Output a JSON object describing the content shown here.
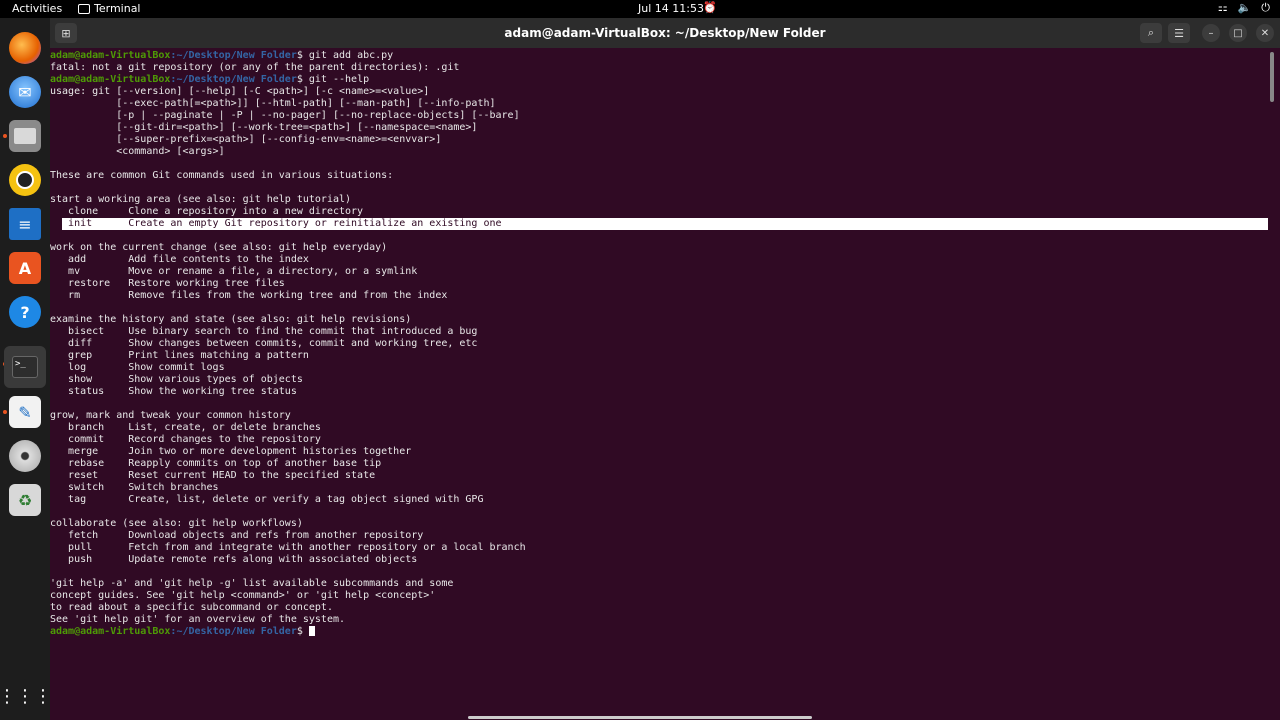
{
  "topbar": {
    "activities": "Activities",
    "app_name": "Terminal",
    "clock": "Jul 14  11:53"
  },
  "dock": {
    "items": [
      "firefox-icon",
      "thunderbird-icon",
      "files-icon",
      "rhythmbox-icon",
      "writer-icon",
      "software-icon",
      "help-icon",
      "terminal-icon",
      "text-editor-icon",
      "disc-icon",
      "trash-icon",
      "show-apps-icon"
    ]
  },
  "window": {
    "title": "adam@adam-VirtualBox: ~/Desktop/New Folder"
  },
  "prompt": {
    "user": "adam@adam-VirtualBox",
    "path": ":~/Desktop/New Folder",
    "symbol": "$ "
  },
  "commands": {
    "cmd1": "git add abc.py",
    "cmd2": "git --help"
  },
  "output": {
    "l01": "fatal: not a git repository (or any of the parent directories): .git",
    "l03": "usage: git [--version] [--help] [-C <path>] [-c <name>=<value>]",
    "l04": "           [--exec-path[=<path>]] [--html-path] [--man-path] [--info-path]",
    "l05": "           [-p | --paginate | -P | --no-pager] [--no-replace-objects] [--bare]",
    "l06": "           [--git-dir=<path>] [--work-tree=<path>] [--namespace=<name>]",
    "l07": "           [--super-prefix=<path>] [--config-env=<name>=<envvar>]",
    "l08": "           <command> [<args>]",
    "l10": "These are common Git commands used in various situations:",
    "l12": "start a working area (see also: git help tutorial)",
    "l13": "   clone     Clone a repository into a new directory",
    "l14": "   init      Create an empty Git repository or reinitialize an existing one",
    "l16": "work on the current change (see also: git help everyday)",
    "l17": "   add       Add file contents to the index",
    "l18": "   mv        Move or rename a file, a directory, or a symlink",
    "l19": "   restore   Restore working tree files",
    "l20": "   rm        Remove files from the working tree and from the index",
    "l22": "examine the history and state (see also: git help revisions)",
    "l23": "   bisect    Use binary search to find the commit that introduced a bug",
    "l24": "   diff      Show changes between commits, commit and working tree, etc",
    "l25": "   grep      Print lines matching a pattern",
    "l26": "   log       Show commit logs",
    "l27": "   show      Show various types of objects",
    "l28": "   status    Show the working tree status",
    "l30": "grow, mark and tweak your common history",
    "l31": "   branch    List, create, or delete branches",
    "l32": "   commit    Record changes to the repository",
    "l33": "   merge     Join two or more development histories together",
    "l34": "   rebase    Reapply commits on top of another base tip",
    "l35": "   reset     Reset current HEAD to the specified state",
    "l36": "   switch    Switch branches",
    "l37": "   tag       Create, list, delete or verify a tag object signed with GPG",
    "l39": "collaborate (see also: git help workflows)",
    "l40": "   fetch     Download objects and refs from another repository",
    "l41": "   pull      Fetch from and integrate with another repository or a local branch",
    "l42": "   push      Update remote refs along with associated objects",
    "l44": "'git help -a' and 'git help -g' list available subcommands and some",
    "l45": "concept guides. See 'git help <command>' or 'git help <concept>'",
    "l46": "to read about a specific subcommand or concept.",
    "l47": "See 'git help git' for an overview of the system."
  }
}
